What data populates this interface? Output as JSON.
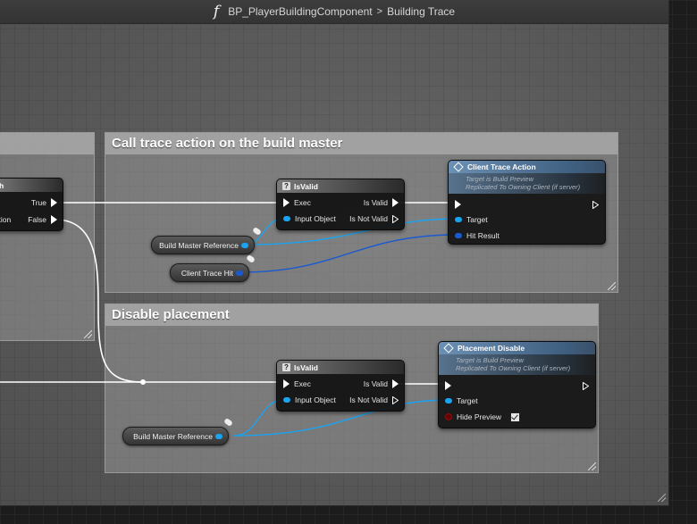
{
  "titlebar": {
    "function_icon": "f",
    "blueprint": "BP_PlayerBuildingComponent",
    "separator": ">",
    "function": "Building Trace"
  },
  "left_node": {
    "title_fragment": "h",
    "true_label": "True",
    "false_label": "False",
    "false_prefix": "tion"
  },
  "comments": {
    "call_trace": "Call trace action on the build master",
    "disable_placement": "Disable placement"
  },
  "isvalid_1": {
    "title": "IsValid",
    "exec": "Exec",
    "input": "Input Object",
    "is_valid": "Is Valid",
    "is_not_valid": "Is Not Valid"
  },
  "isvalid_2": {
    "title": "IsValid",
    "exec": "Exec",
    "input": "Input Object",
    "is_valid": "Is Valid",
    "is_not_valid": "Is Not Valid"
  },
  "client_trace": {
    "title": "Client Trace Action",
    "target_is": "Target is Build Preview",
    "replicated": "Replicated To Owning Client (if server)",
    "target": "Target",
    "hit_result": "Hit Result"
  },
  "placement_disable": {
    "title": "Placement Disable",
    "target_is": "Target is Build Preview",
    "replicated": "Replicated To Owning Client (if server)",
    "target": "Target",
    "hide_preview": "Hide Preview",
    "hide_preview_checked": true
  },
  "variables": {
    "build_master_ref_1": "Build Master Reference",
    "client_trace_hit": "Client Trace Hit",
    "build_master_ref_2": "Build Master Reference"
  },
  "colors": {
    "exec_wire": "#ffffff",
    "object_pin": "#1aa3f0",
    "struct_wire": "#1a5ad0",
    "function_header": "#6c90b4",
    "bool_pin": "#6a0000"
  }
}
